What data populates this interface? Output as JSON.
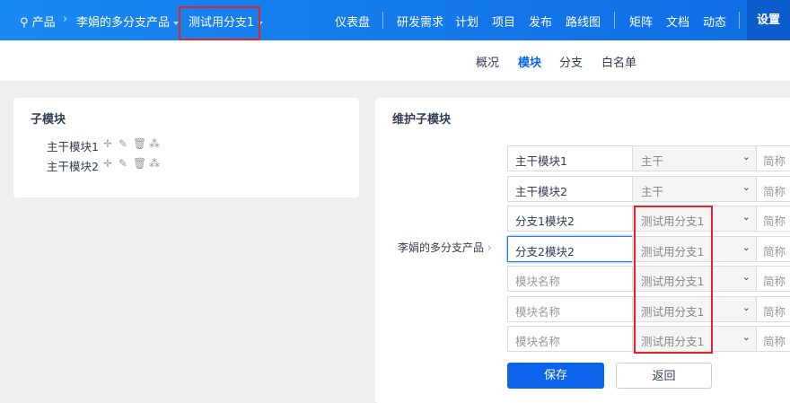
{
  "header": {
    "breadcrumb": [
      {
        "label": "产品",
        "icon": "lightbulb-icon"
      },
      {
        "label": "李娟的多分支产品"
      },
      {
        "label": "测试用分支1"
      }
    ],
    "nav": [
      "仪表盘",
      "研发需求",
      "计划",
      "项目",
      "发布",
      "路线图",
      "矩阵",
      "文档",
      "动态"
    ],
    "settings": "设置"
  },
  "subnav": {
    "items": [
      "概况",
      "模块",
      "分支",
      "白名单"
    ],
    "active": "模块"
  },
  "left": {
    "title": "子模块",
    "modules": [
      "主干模块1",
      "主干模块2"
    ]
  },
  "right": {
    "title": "维护子模块",
    "parent_label": "李娟的多分支产品",
    "rows": [
      {
        "name": "主干模块1",
        "placeholder": "模块名称",
        "branch": "主干",
        "abbr": "简称"
      },
      {
        "name": "主干模块2",
        "placeholder": "模块名称",
        "branch": "主干",
        "abbr": "简称"
      },
      {
        "name": "分支1模块2",
        "placeholder": "模块名称",
        "branch": "测试用分支1",
        "abbr": "简称"
      },
      {
        "name": "分支2模块2",
        "placeholder": "模块名称",
        "branch": "测试用分支1",
        "abbr": "简称"
      },
      {
        "name": "",
        "placeholder": "模块名称",
        "branch": "测试用分支1",
        "abbr": "简称"
      },
      {
        "name": "",
        "placeholder": "模块名称",
        "branch": "测试用分支1",
        "abbr": "简称"
      },
      {
        "name": "",
        "placeholder": "模块名称",
        "branch": "测试用分支1",
        "abbr": "简称"
      }
    ],
    "save": "保存",
    "back": "返回"
  },
  "colors": {
    "primary": "#0c64eb",
    "highlight": "#e3232b"
  }
}
